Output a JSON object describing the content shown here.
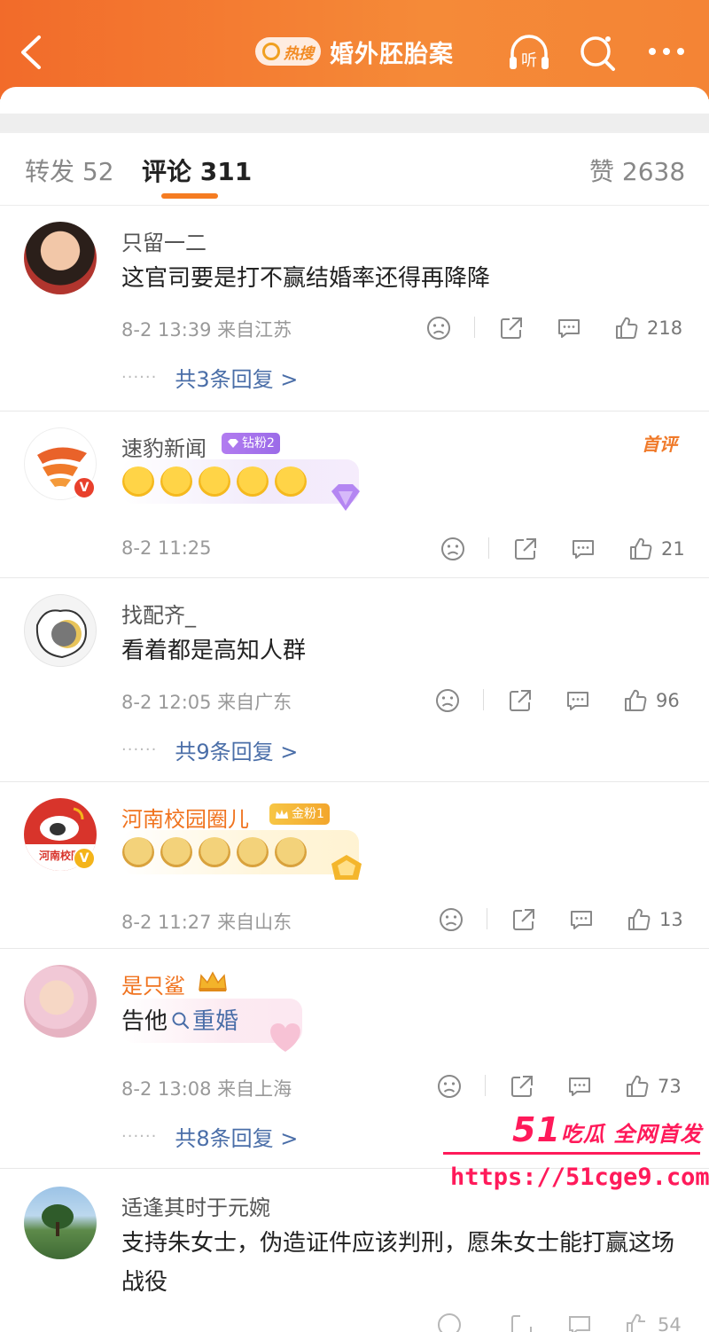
{
  "header": {
    "hot_badge": "热搜",
    "title": "婚外胚胎案"
  },
  "tabs": [
    {
      "label": "转发",
      "count": "52"
    },
    {
      "label": "评论",
      "count": "311"
    },
    {
      "label": "赞",
      "count": "2638"
    }
  ],
  "comments": [
    {
      "name": "只留一二",
      "text": "这官司要是打不赢结婚率还得再降降",
      "meta": "8-2 13:39  来自江苏",
      "likes": "218",
      "replies": "共3条回复 >"
    },
    {
      "name": "速豹新闻",
      "fan_badge": "钻粉2",
      "first_tag": "首评",
      "emoji_count": 5,
      "meta": "8-2 11:25",
      "likes": "21"
    },
    {
      "name": "找配齐_",
      "text": "看着都是高知人群",
      "meta": "8-2 12:05  来自广东",
      "likes": "96",
      "replies": "共9条回复 >"
    },
    {
      "name": "河南校园圈儿",
      "fan_badge": "金粉1",
      "avatar_text": "河南校园",
      "emoji_count": 5,
      "meta": "8-2 11:27  来自山东",
      "likes": "13"
    },
    {
      "name": "是只鲨",
      "text_prefix": "告他",
      "search_link": "重婚",
      "meta": "8-2 13:08  来自上海",
      "likes": "73",
      "replies": "共8条回复 >"
    },
    {
      "name": "适逢其时于元婉",
      "text": "支持朱女士，伪造证件应该判刑，愿朱女士能打赢这场战役",
      "likes": "54"
    }
  ],
  "watermark": {
    "line1_num": "51",
    "line1_text": "吃瓜 全网首发",
    "url": "https://51cge9.com"
  },
  "colors": {
    "header_orange": "#f47a2f",
    "accent": "#f57c22",
    "link_blue": "#4a6ea8",
    "watermark_red": "#ff1a5a"
  }
}
